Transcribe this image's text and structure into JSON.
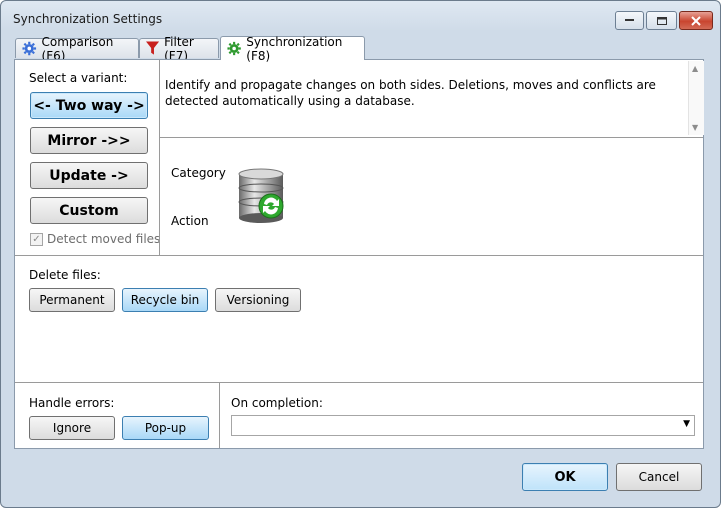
{
  "window": {
    "title": "Synchronization Settings"
  },
  "tabs": [
    {
      "label": "Comparison (F6)",
      "icon": "gear-icon"
    },
    {
      "label": "Filter (F7)",
      "icon": "filter-icon"
    },
    {
      "label": "Synchronization (F8)",
      "icon": "gear-icon"
    }
  ],
  "variant": {
    "heading": "Select a variant:",
    "buttons": [
      "<- Two way ->",
      "Mirror ->>",
      "Update ->",
      "Custom"
    ],
    "selected": "<- Two way ->",
    "detect_moved_label": "Detect moved files",
    "detect_moved_checked": true
  },
  "description": "Identify and propagate changes on both sides. Deletions, moves and conflicts are detected automatically using a database.",
  "info": {
    "category_label": "Category",
    "action_label": "Action",
    "icon": "database-sync-icon"
  },
  "delete_files": {
    "heading": "Delete files:",
    "options": [
      "Permanent",
      "Recycle bin",
      "Versioning"
    ],
    "selected": "Recycle bin"
  },
  "handle_errors": {
    "heading": "Handle errors:",
    "options": [
      "Ignore",
      "Pop-up"
    ],
    "selected": "Pop-up"
  },
  "on_completion": {
    "heading": "On completion:",
    "value": ""
  },
  "footer": {
    "ok_label": "OK",
    "cancel_label": "Cancel"
  },
  "colors": {
    "accent": "#a9d8f7",
    "accent_border": "#3c7fb1",
    "close_button": "#c9452f"
  }
}
